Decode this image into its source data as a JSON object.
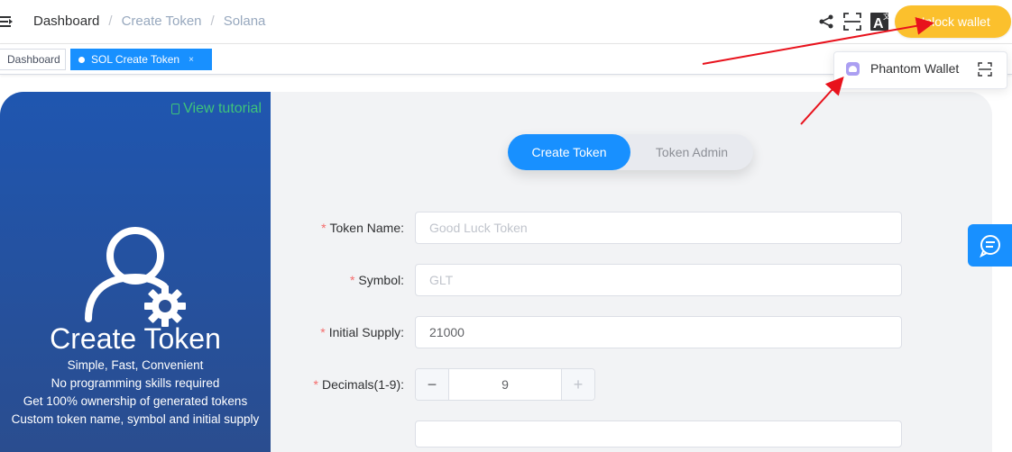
{
  "header": {
    "breadcrumb": [
      "Dashboard",
      "Create Token",
      "Solana"
    ],
    "separator": "/",
    "unlock_label": "Unlock wallet",
    "icons": [
      "hamburger-icon",
      "share-icon",
      "fullscreen-icon",
      "translate-icon"
    ]
  },
  "tabs": [
    {
      "label": "Dashboard",
      "active": false
    },
    {
      "label": "SOL Create Token",
      "active": true,
      "close": "×"
    }
  ],
  "wallet_menu": {
    "item_label": "Phantom Wallet"
  },
  "left_panel": {
    "tutorial_label": "View tutorial",
    "title": "Create Token",
    "lines": [
      "Simple, Fast, Convenient",
      "No programming skills required",
      "Get 100% ownership of generated tokens",
      "Custom token name, symbol and initial supply"
    ]
  },
  "toggle": {
    "active": "Create Token",
    "inactive": "Token Admin"
  },
  "form": {
    "required_mark": "*",
    "token_name": {
      "label": "Token Name:",
      "placeholder": "Good Luck Token"
    },
    "symbol": {
      "label": "Symbol:",
      "placeholder": "GLT"
    },
    "supply": {
      "label": "Initial Supply:",
      "value": "21000"
    },
    "decimals": {
      "label": "Decimals(1-9):",
      "value": "9",
      "minus": "−",
      "plus": "+"
    }
  },
  "colors": {
    "primary": "#1890ff",
    "unlock": "#fbc02d",
    "tutorial": "#3ec47a",
    "required": "#f56c6c",
    "arrow": "#e8121c"
  }
}
